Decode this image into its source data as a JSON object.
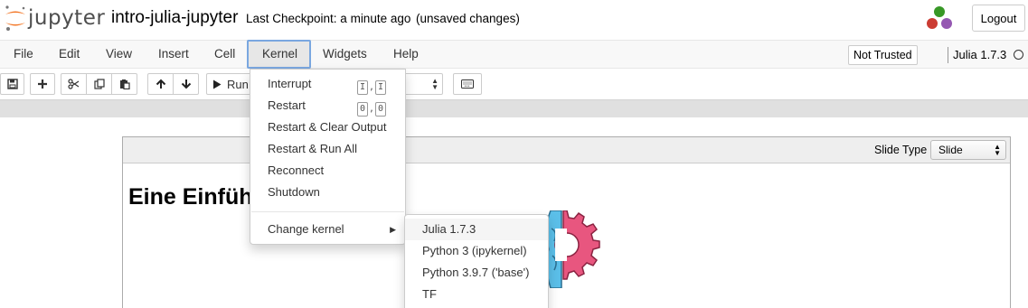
{
  "header": {
    "logo_text": "jupyter",
    "notebook_name": "intro-julia-jupyter",
    "checkpoint": "Last Checkpoint: a minute ago",
    "autosave_status": "(unsaved changes)",
    "logout_label": "Logout"
  },
  "menubar": {
    "items": [
      {
        "label": "File"
      },
      {
        "label": "Edit"
      },
      {
        "label": "View"
      },
      {
        "label": "Insert"
      },
      {
        "label": "Cell"
      },
      {
        "label": "Kernel",
        "active": true
      },
      {
        "label": "Widgets"
      },
      {
        "label": "Help"
      }
    ],
    "not_trusted_label": "Not Trusted",
    "kernel_name": "Julia 1.7.3"
  },
  "toolbar": {
    "run_label": "Run",
    "icons": [
      "save-icon",
      "plus-icon",
      "cut-icon",
      "copy-icon",
      "paste-icon",
      "arrow-up-icon",
      "arrow-down-icon",
      "play-icon",
      "keyboard-icon"
    ]
  },
  "cell": {
    "slide_type_label": "Slide Type",
    "slide_type_value": "Slide",
    "heading_visible": "Eine Einfüh"
  },
  "kernel_menu": {
    "items": [
      {
        "label": "Interrupt",
        "shortcut": [
          "I",
          "I"
        ]
      },
      {
        "label": "Restart",
        "shortcut": [
          "0",
          "0"
        ]
      },
      {
        "label": "Restart & Clear Output"
      },
      {
        "label": "Restart & Run All"
      },
      {
        "label": "Reconnect"
      },
      {
        "label": "Shutdown"
      }
    ],
    "change_kernel_label": "Change kernel",
    "change_kernel_submenu": [
      {
        "label": "Julia 1.7.3",
        "hover": true
      },
      {
        "label": "Python 3 (ipykernel)"
      },
      {
        "label": "Python 3.9.7 ('base')"
      },
      {
        "label": "TF"
      }
    ]
  },
  "colors": {
    "jupyter_orange": "#f37726",
    "julia_red": "#cb3c33",
    "julia_green": "#389826",
    "julia_purple": "#9558b2",
    "active_menu_border": "#7aa7e0",
    "gear_pink": "#e8567f",
    "brain_blue": "#5bbfe9"
  }
}
